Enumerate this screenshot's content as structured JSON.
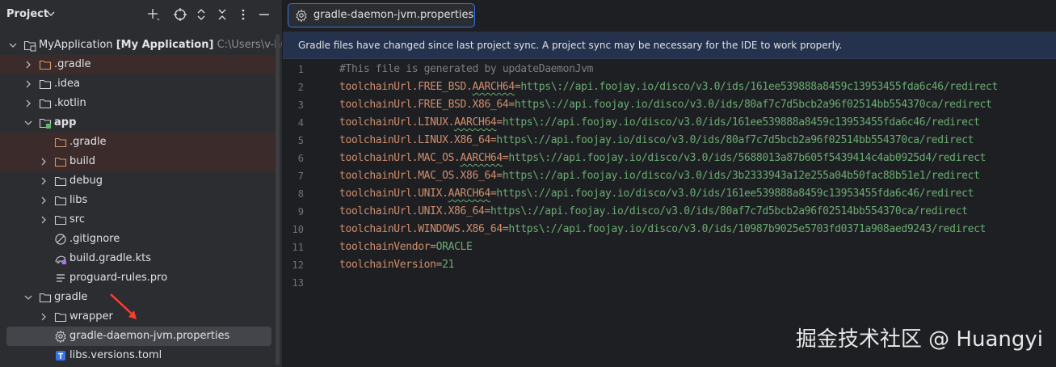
{
  "project_panel": {
    "title": "Project",
    "header_icons": [
      "add-icon",
      "target-icon",
      "expand-collapse-icon",
      "more-icon",
      "minimize-icon"
    ],
    "tree": [
      {
        "label": "MyApplication",
        "bold_suffix": "[My Application]",
        "path": "C:\\Users\\v-huang",
        "icon": "module-folder-icon",
        "chevron": "down"
      },
      {
        "label": ".gradle",
        "icon": "folder-icon",
        "chevron": "right",
        "excluded": true
      },
      {
        "label": ".idea",
        "icon": "folder-icon",
        "chevron": "right"
      },
      {
        "label": ".kotlin",
        "icon": "folder-icon",
        "chevron": "right"
      },
      {
        "label": "app",
        "icon": "module-folder-icon",
        "chevron": "down",
        "bold": true
      },
      {
        "label": ".gradle",
        "icon": "folder-icon",
        "chevron": "none",
        "excluded": true
      },
      {
        "label": "build",
        "icon": "folder-icon",
        "chevron": "right",
        "excluded": true
      },
      {
        "label": "debug",
        "icon": "folder-icon",
        "chevron": "right"
      },
      {
        "label": "libs",
        "icon": "folder-icon",
        "chevron": "right"
      },
      {
        "label": "src",
        "icon": "folder-icon",
        "chevron": "right"
      },
      {
        "label": ".gitignore",
        "icon": "gitignore-icon",
        "chevron": "none"
      },
      {
        "label": "build.gradle.kts",
        "icon": "gradle-file-icon",
        "chevron": "none"
      },
      {
        "label": "proguard-rules.pro",
        "icon": "text-file-icon",
        "chevron": "none"
      },
      {
        "label": "gradle",
        "icon": "folder-icon",
        "chevron": "down"
      },
      {
        "label": "wrapper",
        "icon": "folder-icon",
        "chevron": "right"
      },
      {
        "label": "gradle-daemon-jvm.properties",
        "icon": "properties-file-icon",
        "chevron": "none",
        "selected": true
      },
      {
        "label": "libs.versions.toml",
        "icon": "toml-file-icon",
        "chevron": "none"
      }
    ]
  },
  "editor": {
    "tab_label": "gradle-daemon-jvm.properties",
    "banner": "Gradle files have changed since last project sync. A project sync may be necessary for the IDE to work properly.",
    "lines": [
      {
        "n": "1",
        "comment": "#This file is generated by updateDaemonJvm"
      },
      {
        "n": "2",
        "key": "toolchainUrl.FREE_BSD.",
        "key_sq": "AARCH64",
        "val": "https\\://api.foojay.io/disco/v3.0/ids/161ee539888a8459c13953455fda6c46/redirect"
      },
      {
        "n": "3",
        "key": "toolchainUrl.FREE_BSD.X86_64",
        "key_sq": "",
        "val": "https\\://api.foojay.io/disco/v3.0/ids/80af7c7d5bcb2a96f02514bb554370ca/redirect"
      },
      {
        "n": "4",
        "key": "toolchainUrl.LINUX.",
        "key_sq": "AARCH64",
        "val": "https\\://api.foojay.io/disco/v3.0/ids/161ee539888a8459c13953455fda6c46/redirect"
      },
      {
        "n": "5",
        "key": "toolchainUrl.LINUX.X86_64",
        "key_sq": "",
        "val": "https\\://api.foojay.io/disco/v3.0/ids/80af7c7d5bcb2a96f02514bb554370ca/redirect"
      },
      {
        "n": "6",
        "key": "toolchainUrl.MAC_OS.",
        "key_sq": "AARCH64",
        "val": "https\\://api.foojay.io/disco/v3.0/ids/5688013a87b605f5439414c4ab0925d4/redirect"
      },
      {
        "n": "7",
        "key": "toolchainUrl.MAC_OS.X86_64",
        "key_sq": "",
        "val": "https\\://api.foojay.io/disco/v3.0/ids/3b2333943a12e255a04b50fac88b51e1/redirect"
      },
      {
        "n": "8",
        "key": "toolchainUrl.UNIX.",
        "key_sq": "AARCH64",
        "val": "https\\://api.foojay.io/disco/v3.0/ids/161ee539888a8459c13953455fda6c46/redirect"
      },
      {
        "n": "9",
        "key": "toolchainUrl.UNIX.X86_64",
        "key_sq": "",
        "val": "https\\://api.foojay.io/disco/v3.0/ids/80af7c7d5bcb2a96f02514bb554370ca/redirect"
      },
      {
        "n": "10",
        "key": "toolchainUrl.WINDOWS.X86_64",
        "key_sq": "",
        "val": "https\\://api.foojay.io/disco/v3.0/ids/10987b9025e5703fd0371a908aed9243/redirect"
      },
      {
        "n": "11",
        "key": "toolchainVendor",
        "key_sq": "",
        "val": "ORACLE"
      },
      {
        "n": "12",
        "key": "toolchainVersion",
        "key_sq": "",
        "val": "21"
      },
      {
        "n": "13",
        "key": "",
        "key_sq": "",
        "val": ""
      }
    ]
  },
  "watermark": "掘金技术社区 @ Huangyi",
  "colors": {
    "panel_bg": "#2b2d30",
    "editor_bg": "#1e1f22",
    "accent": "#3574f0",
    "banner_bg": "#25324d",
    "excluded_bg": "#3b2b2a",
    "key": "#cf8e6d",
    "value": "#6aab73",
    "comment": "#7a7e85"
  }
}
